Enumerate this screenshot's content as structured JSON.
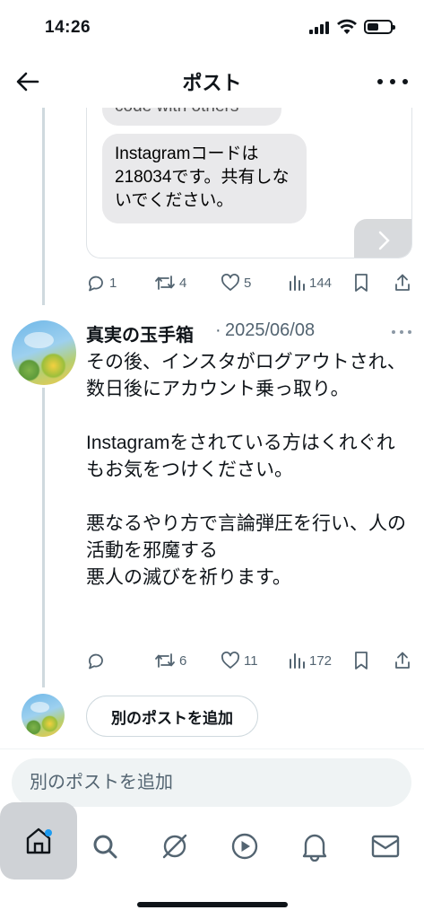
{
  "status_bar": {
    "time": "14:26"
  },
  "header": {
    "title": "ポスト"
  },
  "media": {
    "partial_bubble_text": "code with others",
    "bubble_text": "Instagramコードは218034です。共有しないでください。"
  },
  "first_post_actions": {
    "replies": "1",
    "reposts": "4",
    "likes": "5",
    "views": "144"
  },
  "reply_post": {
    "author_name": "真実の玉手箱",
    "separator": "·",
    "date": "2025/06/08",
    "body": "その後、インスタがログアウトされ、数日後にアカウント乗っ取り。\n\nInstagramをされている方はくれぐれもお気をつけください。\n\n悪なるやり方で言論弾圧を行い、人の活動を邪魔する\n悪人の滅びを祈ります。",
    "actions": {
      "replies": "",
      "reposts": "6",
      "likes": "11",
      "views": "172"
    }
  },
  "add_post": {
    "button_label": "別のポストを追加"
  },
  "compose": {
    "placeholder": "別のポストを追加"
  },
  "tab_bar": {
    "items": [
      "home-icon",
      "search-icon",
      "grok-icon",
      "video-icon",
      "notifications-icon",
      "messages-icon"
    ],
    "active": "home",
    "home_has_badge": true
  },
  "colors": {
    "accent": "#1d9bf0",
    "text": "#0f1419",
    "secondary": "#536471",
    "bubble": "#e9e9eb"
  }
}
